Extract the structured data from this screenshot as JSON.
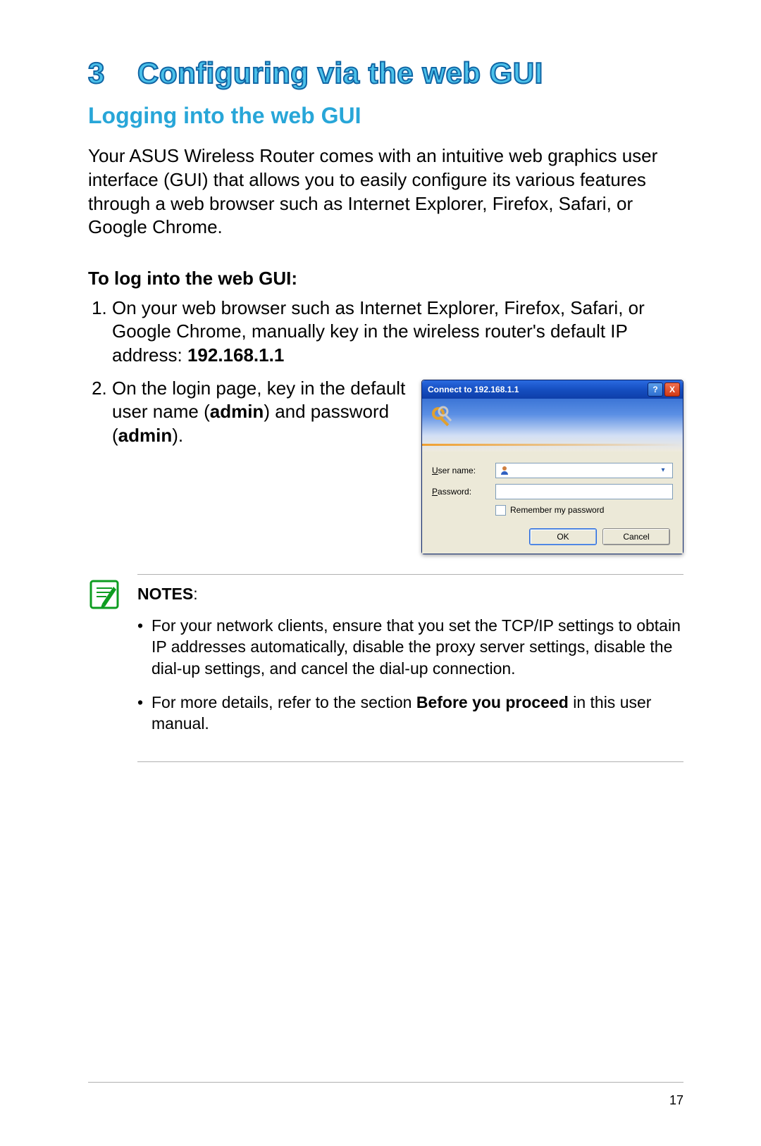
{
  "chapter": {
    "number": "3",
    "title": "Configuring via the web GUI"
  },
  "section_title": "Logging into the web GUI",
  "intro": "Your ASUS Wireless Router comes with an intuitive web graphics user interface (GUI) that allows you to easily configure its various features through a web browser such as Internet Explorer, Firefox, Safari, or Google Chrome.",
  "procedure_heading": "To log into the web GUI:",
  "step1_pre": "On your web browser such as Internet Explorer, Firefox, Safari, or Google Chrome, manually key in the wireless router's default IP address: ",
  "step1_bold": "192.168.1.1",
  "step2_a": "On the login page, key in the default user name (",
  "step2_b": "admin",
  "step2_c": ") and password (",
  "step2_d": "admin",
  "step2_e": ").",
  "dialog": {
    "title": "Connect to 192.168.1.1",
    "help_btn": "?",
    "close_btn": "X",
    "username_label_u": "U",
    "username_label_rest": "ser name:",
    "password_label_u": "P",
    "password_label_rest": "assword:",
    "remember_u": "R",
    "remember_rest": "emember my password",
    "ok": "OK",
    "cancel": "Cancel"
  },
  "notes": {
    "label": "NOTES",
    "colon": ":",
    "item1": "For your network clients, ensure that you set the TCP/IP settings to obtain IP addresses automatically, disable the proxy server settings, disable the dial-up settings, and cancel the dial-up connection.",
    "item2_a": "For more details, refer to the section ",
    "item2_b": "Before you proceed",
    "item2_c": " in this user manual."
  },
  "page_number": "17"
}
